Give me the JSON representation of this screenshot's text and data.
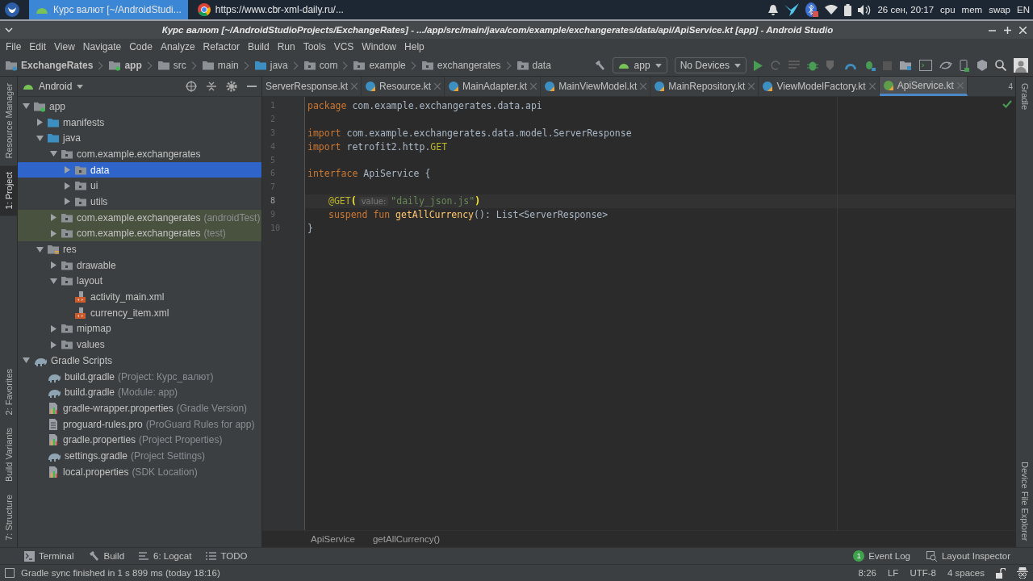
{
  "taskbar": {
    "tasks": [
      {
        "label": "Курс валют [~/AndroidStudi...",
        "selected": true,
        "kind": "studio"
      },
      {
        "label": "https://www.cbr-xml-daily.ru/...",
        "selected": false,
        "kind": "browser"
      }
    ],
    "clock": "26 сен, 20:17",
    "monitors": [
      "cpu",
      "mem",
      "swap"
    ],
    "layout": "EN"
  },
  "window": {
    "title": "Курс валют [~/AndroidStudioProjects/ExchangeRates] - .../app/src/main/java/com/example/exchangerates/data/api/ApiService.kt [app] - Android Studio"
  },
  "menu": [
    "File",
    "Edit",
    "View",
    "Navigate",
    "Code",
    "Analyze",
    "Refactor",
    "Build",
    "Run",
    "Tools",
    "VCS",
    "Window",
    "Help"
  ],
  "breadcrumbs": [
    {
      "label": "ExchangeRates",
      "kind": "project"
    },
    {
      "label": "app",
      "kind": "module"
    },
    {
      "label": "src",
      "kind": "folder"
    },
    {
      "label": "main",
      "kind": "folder"
    },
    {
      "label": "java",
      "kind": "source"
    },
    {
      "label": "com",
      "kind": "package"
    },
    {
      "label": "example",
      "kind": "package"
    },
    {
      "label": "exchangerates",
      "kind": "package"
    },
    {
      "label": "data",
      "kind": "package"
    }
  ],
  "toolbar": {
    "run_config": "app",
    "device": "No Devices"
  },
  "left_strip": [
    {
      "label": "Resource Manager",
      "selected": false
    },
    {
      "label": "1: Project",
      "selected": true
    },
    {
      "label": "2: Favorites",
      "selected": false
    },
    {
      "label": "Build Variants",
      "selected": false
    },
    {
      "label": "7: Structure",
      "selected": false
    }
  ],
  "right_strip": [
    {
      "label": "Gradle",
      "selected": false
    },
    {
      "label": "Device File Explorer",
      "selected": false
    }
  ],
  "project": {
    "view": "Android",
    "tree": [
      {
        "label": "app",
        "kind": "module",
        "expanded": true,
        "selected": false,
        "tinted": false,
        "children": [
          {
            "label": "manifests",
            "kind": "source",
            "expanded": false,
            "selected": false,
            "tinted": false
          },
          {
            "label": "java",
            "kind": "source",
            "expanded": true,
            "selected": false,
            "tinted": false,
            "children": [
              {
                "label": "com.example.exchangerates",
                "kind": "package",
                "expanded": true,
                "selected": false,
                "tinted": false,
                "children": [
                  {
                    "label": "data",
                    "kind": "package",
                    "expanded": false,
                    "selected": true,
                    "tinted": false
                  },
                  {
                    "label": "ui",
                    "kind": "package",
                    "expanded": false,
                    "selected": false,
                    "tinted": false
                  },
                  {
                    "label": "utils",
                    "kind": "package",
                    "expanded": false,
                    "selected": false,
                    "tinted": false
                  }
                ]
              },
              {
                "label": "com.example.exchangerates",
                "hint": "(androidTest)",
                "kind": "package",
                "expanded": false,
                "selected": false,
                "tinted": true
              },
              {
                "label": "com.example.exchangerates",
                "hint": "(test)",
                "kind": "package",
                "expanded": false,
                "selected": false,
                "tinted": true
              }
            ]
          },
          {
            "label": "res",
            "kind": "res",
            "expanded": true,
            "selected": false,
            "tinted": false,
            "children": [
              {
                "label": "drawable",
                "kind": "package",
                "expanded": false,
                "selected": false,
                "tinted": false
              },
              {
                "label": "layout",
                "kind": "package",
                "expanded": true,
                "selected": false,
                "tinted": false,
                "children": [
                  {
                    "label": "activity_main.xml",
                    "kind": "xml",
                    "selected": false,
                    "tinted": false
                  },
                  {
                    "label": "currency_item.xml",
                    "kind": "xml",
                    "selected": false,
                    "tinted": false
                  }
                ]
              },
              {
                "label": "mipmap",
                "kind": "package",
                "expanded": false,
                "selected": false,
                "tinted": false
              },
              {
                "label": "values",
                "kind": "package",
                "expanded": false,
                "selected": false,
                "tinted": false
              }
            ]
          }
        ]
      },
      {
        "label": "Gradle Scripts",
        "kind": "gradle",
        "expanded": true,
        "selected": false,
        "tinted": false,
        "children": [
          {
            "label": "build.gradle",
            "hint": "(Project: Курс_валют)",
            "kind": "gradle",
            "selected": false,
            "tinted": false
          },
          {
            "label": "build.gradle",
            "hint": "(Module: app)",
            "kind": "gradle",
            "selected": false,
            "tinted": false
          },
          {
            "label": "gradle-wrapper.properties",
            "hint": "(Gradle Version)",
            "kind": "props",
            "selected": false,
            "tinted": false
          },
          {
            "label": "proguard-rules.pro",
            "hint": "(ProGuard Rules for app)",
            "kind": "file",
            "selected": false,
            "tinted": false
          },
          {
            "label": "gradle.properties",
            "hint": "(Project Properties)",
            "kind": "props",
            "selected": false,
            "tinted": false
          },
          {
            "label": "settings.gradle",
            "hint": "(Project Settings)",
            "kind": "gradle",
            "selected": false,
            "tinted": false
          },
          {
            "label": "local.properties",
            "hint": "(SDK Location)",
            "kind": "props",
            "selected": false,
            "tinted": false
          }
        ]
      }
    ]
  },
  "editor": {
    "tabs": [
      {
        "label": "ServerResponse.kt",
        "selected": false,
        "kind": "clipped"
      },
      {
        "label": "Resource.kt",
        "selected": false,
        "kind": "class"
      },
      {
        "label": "MainAdapter.kt",
        "selected": false,
        "kind": "class"
      },
      {
        "label": "MainViewModel.kt",
        "selected": false,
        "kind": "class"
      },
      {
        "label": "MainRepository.kt",
        "selected": false,
        "kind": "class"
      },
      {
        "label": "ViewModelFactory.kt",
        "selected": false,
        "kind": "class"
      },
      {
        "label": "ApiService.kt",
        "selected": true,
        "kind": "interface"
      }
    ],
    "hidden_tabs": "4",
    "lines": [
      {
        "number": "1",
        "current": false,
        "indented": false,
        "tokens": [
          {
            "kind": "kw",
            "text": "package"
          },
          {
            "kind": "plain",
            "text": " com.example.exchangerates.data.api"
          }
        ]
      },
      {
        "number": "2",
        "current": false
      },
      {
        "number": "3",
        "current": false,
        "indented": false,
        "tokens": [
          {
            "kind": "kw",
            "text": "import"
          },
          {
            "kind": "plain",
            "text": " com.example.exchangerates.data.model.ServerResponse"
          }
        ]
      },
      {
        "number": "4",
        "current": false,
        "indented": false,
        "tokens": [
          {
            "kind": "kw",
            "text": "import"
          },
          {
            "kind": "plain",
            "text": " retrofit2.http."
          },
          {
            "kind": "ann",
            "text": "GET"
          }
        ]
      },
      {
        "number": "5",
        "current": false
      },
      {
        "number": "6",
        "current": false,
        "indented": false,
        "tokens": [
          {
            "kind": "kw",
            "text": "interface"
          },
          {
            "kind": "plain",
            "text": " ApiService {"
          }
        ]
      },
      {
        "number": "7",
        "current": false
      },
      {
        "number": "8",
        "current": true,
        "indented": true,
        "tokens": [
          {
            "kind": "ann",
            "text": "@GET"
          },
          {
            "kind": "brace",
            "text": "("
          },
          {
            "kind": "hint",
            "text": "value:"
          },
          {
            "kind": "str",
            "text": "\"daily_json.js\""
          },
          {
            "kind": "brace",
            "text": ")"
          }
        ]
      },
      {
        "number": "9",
        "current": false,
        "indented": true,
        "tokens": [
          {
            "kind": "kw",
            "text": "suspend fun "
          },
          {
            "kind": "fn",
            "text": "getAllCurrency"
          },
          {
            "kind": "plain",
            "text": "(): List<ServerResponse>"
          }
        ]
      },
      {
        "number": "10",
        "current": false,
        "indented": false,
        "tokens": [
          {
            "kind": "plain",
            "text": "}"
          }
        ]
      }
    ],
    "crumbs": [
      "ApiService",
      "getAllCurrency()"
    ]
  },
  "tool_tabs": [
    {
      "label": "Terminal",
      "kind": "terminal"
    },
    {
      "label": "Build",
      "kind": "hammer"
    },
    {
      "label": "6: Logcat",
      "kind": "logcat"
    },
    {
      "label": "TODO",
      "kind": "list"
    }
  ],
  "right_tools": [
    {
      "label": "Event Log",
      "badge": "1"
    },
    {
      "label": "Layout Inspector"
    }
  ],
  "status_bar": {
    "message": "Gradle sync finished in 1 s 899 ms (today 18:16)",
    "items": [
      "8:26",
      "LF",
      "UTF-8",
      "4 spaces"
    ]
  }
}
